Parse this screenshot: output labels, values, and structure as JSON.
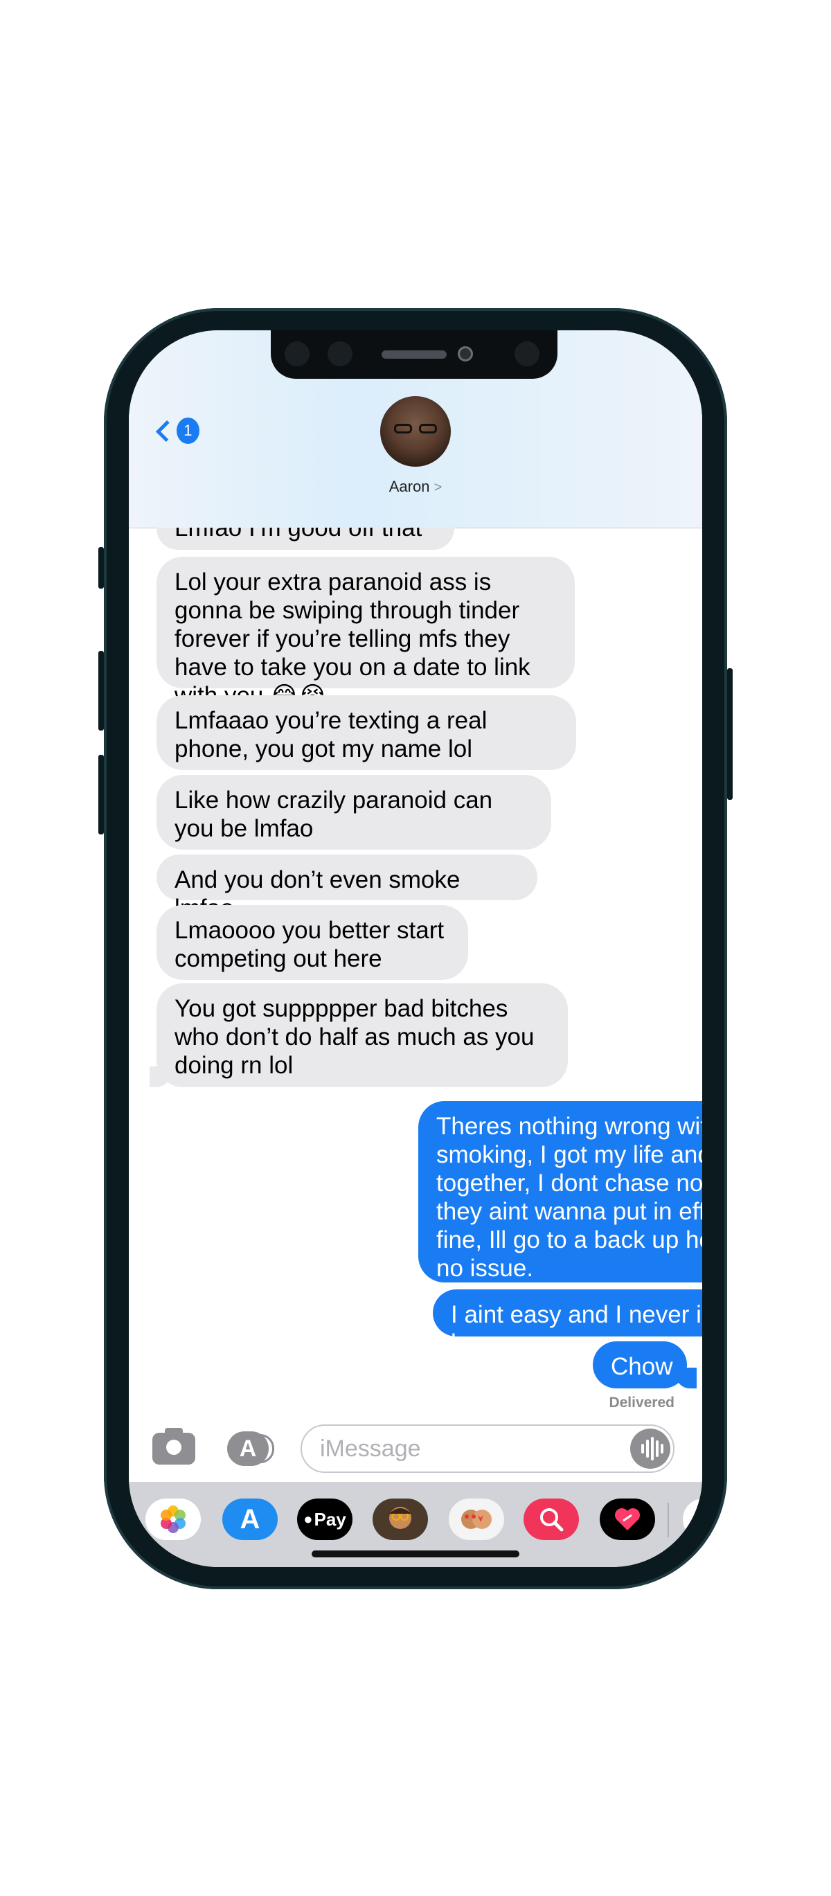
{
  "header": {
    "back_badge_count": "1",
    "contact_name": "Aaron",
    "contact_chevron": ">"
  },
  "messages": [
    {
      "from": "received",
      "text": "Lmfao I’m good off that"
    },
    {
      "from": "received",
      "text": "Lol your extra paranoid ass is gonna be swiping through tinder forever if you’re telling mfs they have to take you on a date to link with you 😂😭"
    },
    {
      "from": "received",
      "text": "Lmfaaao you’re texting a real phone, you got my name lol"
    },
    {
      "from": "received",
      "text": "Like how crazily paranoid can you be lmfao"
    },
    {
      "from": "received",
      "text": "And you don’t even smoke lmfao"
    },
    {
      "from": "received",
      "text": "Lmaoooo you better start competing out here"
    },
    {
      "from": "received",
      "text": "You got suppppper bad bitches who don’t do half as much as you doing rn lol"
    },
    {
      "from": "sent",
      "text": "Theres nothing wrong with me not smoking, I got my life and my shit together, I dont chase nobody, if they aint wanna put in effort thats fine, Ill go to a back up hoe. Aint no issue."
    },
    {
      "from": "sent",
      "text": "I aint easy and I never intend to be"
    },
    {
      "from": "sent",
      "text": "Chow"
    }
  ],
  "status": {
    "delivered": "Delivered"
  },
  "input": {
    "placeholder": "iMessage"
  },
  "app_strip": [
    {
      "icon": "photos-icon"
    },
    {
      "icon": "app-store-icon"
    },
    {
      "icon": "apple-pay-icon",
      "label": "Pay"
    },
    {
      "icon": "memoji-icon"
    },
    {
      "icon": "memoji-stickers-icon"
    },
    {
      "icon": "images-search-icon"
    },
    {
      "icon": "digital-touch-icon"
    }
  ],
  "colors": {
    "sent_bubble": "#1a7cf3",
    "received_bubble": "#e9e9eb",
    "accent": "#1a7cf3"
  }
}
